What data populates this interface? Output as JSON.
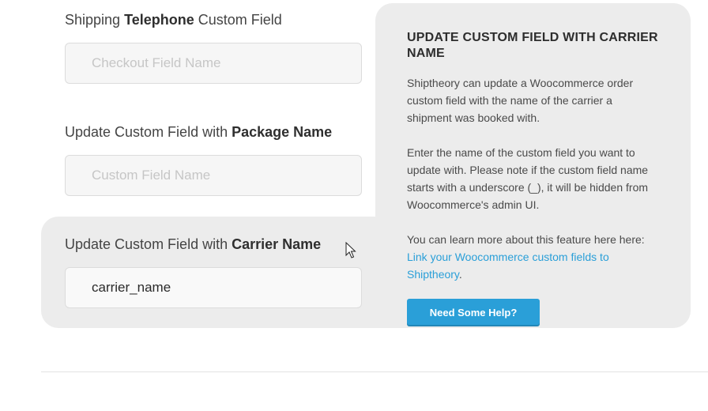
{
  "fields": [
    {
      "label_pre": "Shipping ",
      "label_bold": "Telephone",
      "label_post": " Custom Field",
      "value": "",
      "placeholder": "Checkout Field Name"
    },
    {
      "label_pre": "Update Custom Field with ",
      "label_bold": "Package Name",
      "label_post": "",
      "value": "",
      "placeholder": "Custom Field Name"
    },
    {
      "label_pre": "Update Custom Field with ",
      "label_bold": "Carrier Name",
      "label_post": "",
      "value": "carrier_name",
      "placeholder": ""
    }
  ],
  "help": {
    "title": "UPDATE CUSTOM FIELD WITH CARRIER NAME",
    "para1": "Shiptheory can update a Woocommerce order custom field with the name of the carrier a shipment was booked with.",
    "para2": "Enter the name of the custom field you want to update with. Please note if the custom field name starts with a underscore (_), it will be hidden from Woocommerce's admin UI.",
    "para3_text": "You can learn more about this feature here here: ",
    "para3_link": "Link your Woocommerce custom fields to Shiptheory",
    "para3_end": ".",
    "button": "Need Some Help?"
  },
  "colors": {
    "accent": "#2a9fd8",
    "panel_bg": "#ececec"
  },
  "cursor_icon": "mouse-pointer-icon"
}
